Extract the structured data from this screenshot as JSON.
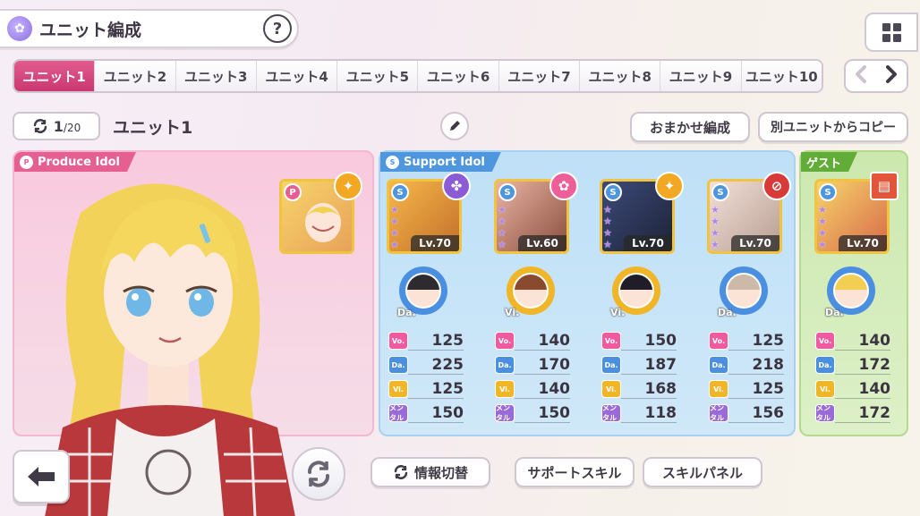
{
  "header": {
    "title": "ユニット編成",
    "help_label": "?"
  },
  "tabs": [
    "ユニット1",
    "ユニット2",
    "ユニット3",
    "ユニット4",
    "ユニット5",
    "ユニット6",
    "ユニット7",
    "ユニット8",
    "ユニット9",
    "ユニット10"
  ],
  "tab_nav": {
    "prev": "‹",
    "next": "›"
  },
  "unit_bar": {
    "count": "1",
    "count_total": "/20",
    "unit_name": "ユニット1",
    "auto_button": "おまかせ編成",
    "copy_button": "別ユニットからコピー"
  },
  "produce": {
    "label": "Produce Idol",
    "label_icon": "P"
  },
  "support": {
    "label": "Support Idol",
    "label_icon": "S",
    "cards": [
      {
        "level": "Lv.70",
        "type": "Da.",
        "stats": {
          "vo": "125",
          "da": "225",
          "vi": "125",
          "me": "150"
        },
        "badge_color": "#8c5bd6"
      },
      {
        "level": "Lv.60",
        "type": "Vi.",
        "stats": {
          "vo": "140",
          "da": "170",
          "vi": "140",
          "me": "150"
        },
        "badge_color": "#ee5f9a"
      },
      {
        "level": "Lv.70",
        "type": "Vi.",
        "stats": {
          "vo": "150",
          "da": "187",
          "vi": "168",
          "me": "118"
        },
        "badge_color": "#f2a822"
      },
      {
        "level": "Lv.70",
        "type": "Da.",
        "stats": {
          "vo": "125",
          "da": "218",
          "vi": "125",
          "me": "156"
        },
        "badge_color": "#d83a3a"
      }
    ]
  },
  "guest": {
    "label": "ゲスト",
    "card": {
      "level": "Lv.70",
      "type": "Da.",
      "stats": {
        "vo": "140",
        "da": "172",
        "vi": "140",
        "me": "172"
      }
    }
  },
  "stat_labels": {
    "vo": "Vo.",
    "da": "Da.",
    "vi": "Vi.",
    "me": "メンタル"
  },
  "bottom": {
    "info_toggle": "情報切替",
    "support_skill": "サポートスキル",
    "skill_panel": "スキルパネル"
  }
}
